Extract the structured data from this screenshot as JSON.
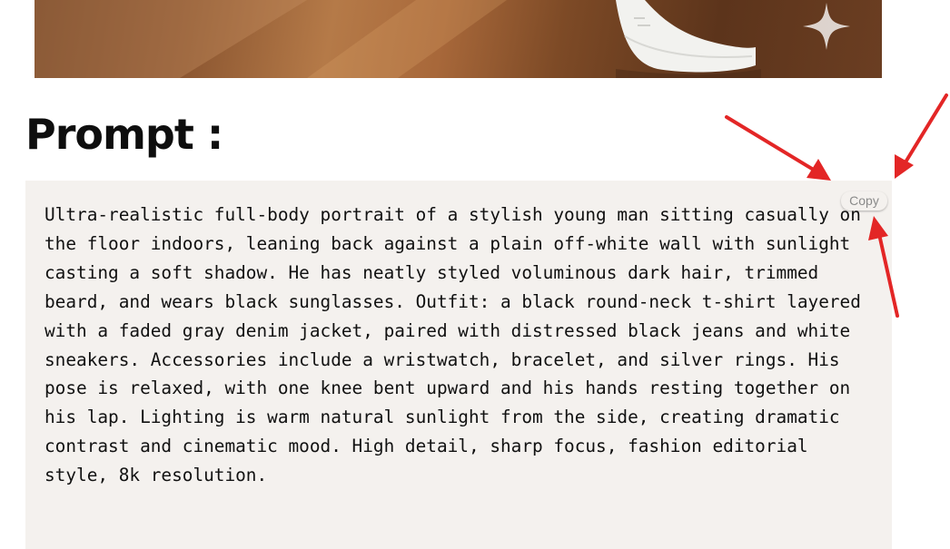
{
  "heading": {
    "title": "Prompt :"
  },
  "prompt": {
    "lines": [
      "Ultra-realistic full-body portrait of a stylish young man sitting casually on",
      "the floor indoors, leaning back against a plain off-white wall with sunlight",
      "casting a soft shadow. He has neatly styled voluminous dark hair, trimmed",
      "beard, and wears black sunglasses. Outfit: a black round-neck t-shirt layered",
      "with a faded gray denim jacket, paired with distressed black jeans and white",
      "sneakers. Accessories include a wristwatch, bracelet, and silver rings. His",
      "pose is relaxed, with one knee bent upward and his hands resting together on",
      "his lap. Lighting is warm natural sunlight from the side, creating dramatic",
      "contrast and cinematic mood. High detail, sharp focus, fashion editorial",
      "style, 8k resolution."
    ]
  },
  "copy_button": {
    "label": "Copy"
  },
  "colors": {
    "prompt_background": "#f4f1ee",
    "annotation_arrow": "#e32626",
    "heading_text": "#0e0e0e"
  },
  "icons": {
    "hero_watermark": "sparkle-icon",
    "annotations": "arrow-icon"
  }
}
